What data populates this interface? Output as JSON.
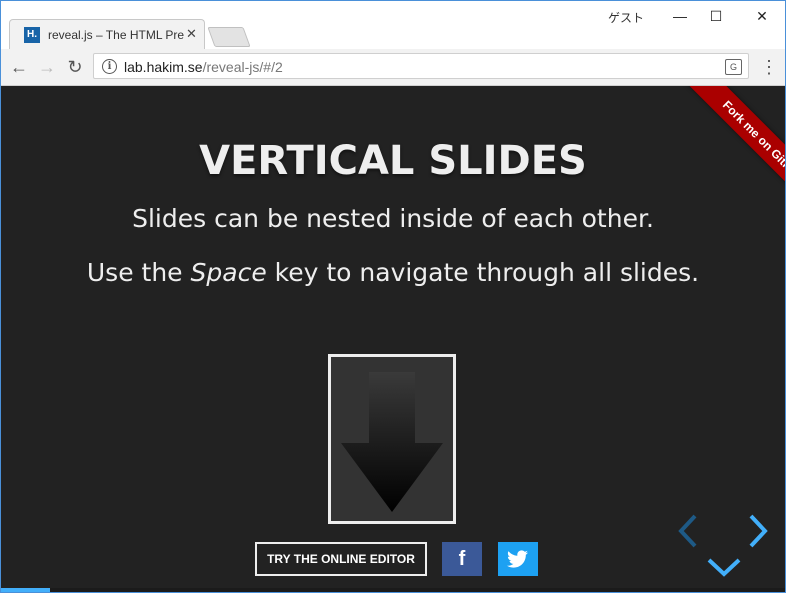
{
  "browser": {
    "tab_title": "reveal.js – The HTML Pres",
    "tab_favicon_text": "H.",
    "guest_label": "ゲスト",
    "url_host": "lab.hakim.se",
    "url_path": "/reveal-js/#/2"
  },
  "slide": {
    "title": "VERTICAL SLIDES",
    "line1": "Slides can be nested inside of each other.",
    "line2_before": "Use the ",
    "line2_em": "Space",
    "line2_after": " key to navigate through all slides.",
    "editor_button": "TRY THE ONLINE EDITOR",
    "facebook_glyph": "f",
    "ribbon_text": "Fork me on GitHub",
    "progress": 0.062
  },
  "colors": {
    "slide_bg": "#222222",
    "accent": "#42affa",
    "ribbon": "#aa0000",
    "facebook": "#3b5998",
    "twitter": "#1da1f2"
  },
  "icons": [
    "back-arrow-icon",
    "forward-arrow-icon",
    "reload-icon",
    "info-icon",
    "translate-icon",
    "menu-icon",
    "down-arrow-icon",
    "twitter-bird-icon",
    "nav-left-icon",
    "nav-right-icon",
    "nav-down-icon"
  ]
}
